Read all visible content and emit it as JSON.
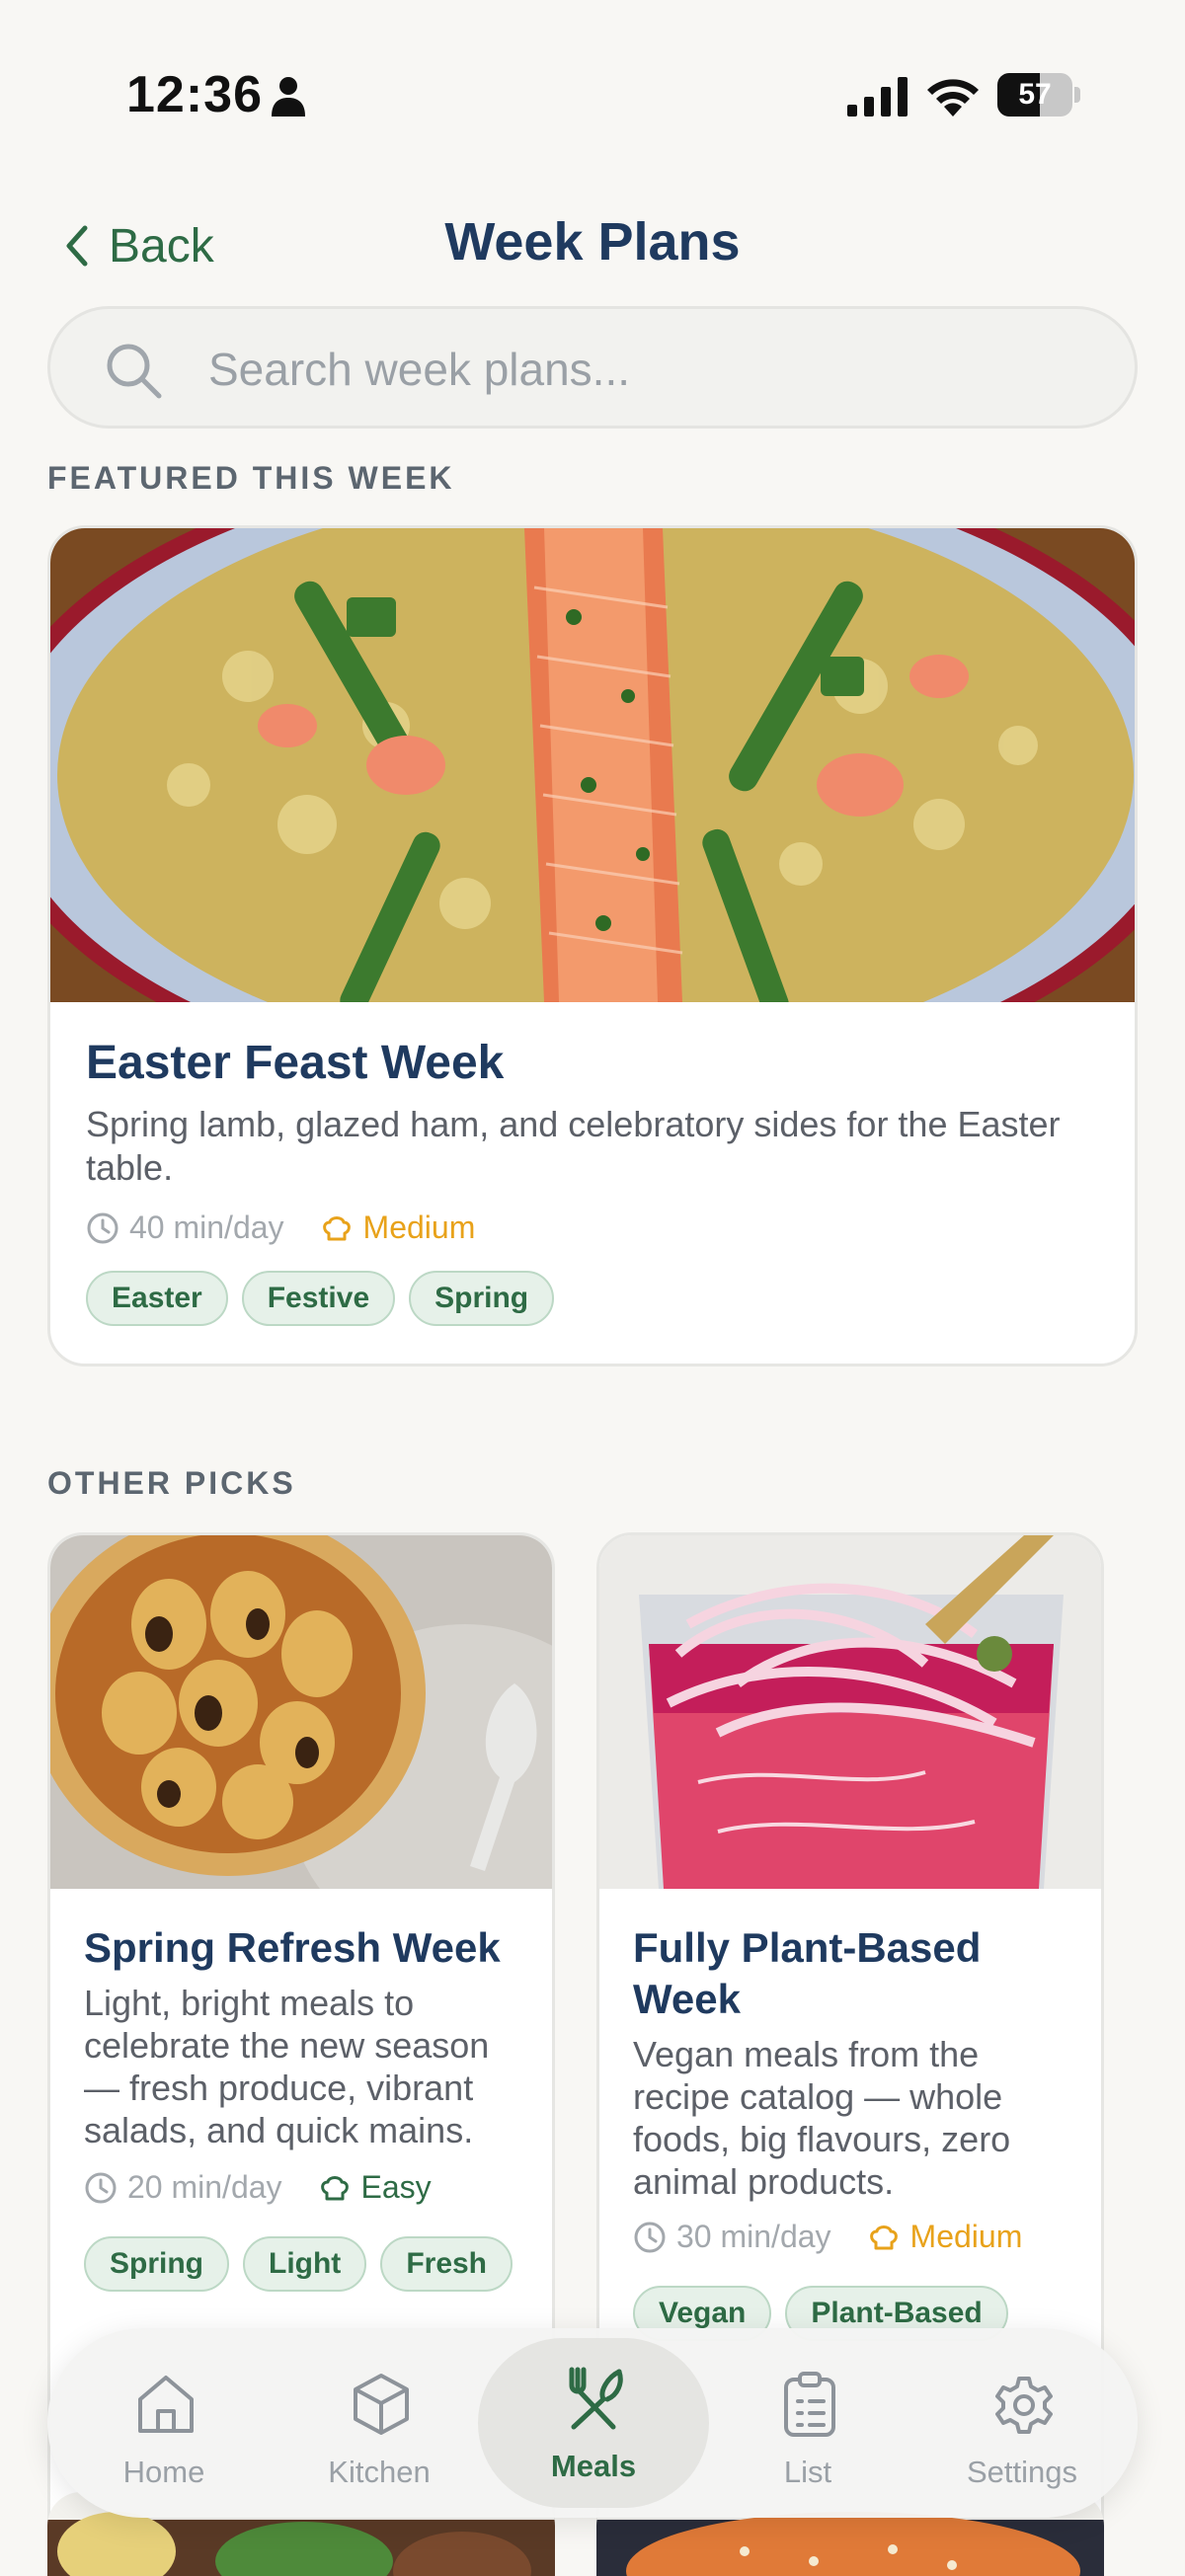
{
  "status_bar": {
    "time": "12:36",
    "battery": "57"
  },
  "header": {
    "back_label": "Back",
    "title": "Week Plans"
  },
  "search": {
    "placeholder": "Search week plans..."
  },
  "featured": {
    "section_label": "FEATURED THIS WEEK",
    "title": "Easter Feast Week",
    "description": "Spring lamb, glazed ham, and celebratory sides for the Easter table.",
    "time": "40 min/day",
    "difficulty": "Medium",
    "tags": [
      "Easter",
      "Festive",
      "Spring"
    ]
  },
  "other_picks": {
    "section_label": "OTHER PICKS",
    "cards": [
      {
        "title": "Spring Refresh Week",
        "description": "Light, bright meals to celebrate the new season — fresh produce, vibrant salads, and quick mains.",
        "time": "20 min/day",
        "difficulty": "Easy",
        "tags": [
          "Spring",
          "Light",
          "Fresh"
        ]
      },
      {
        "title": "Fully Plant-Based Week",
        "description": "Vegan meals from the recipe catalog — whole foods, big flavours, zero animal products.",
        "time": "30 min/day",
        "difficulty": "Medium",
        "tags": [
          "Vegan",
          "Plant-Based"
        ]
      }
    ]
  },
  "tab_bar": {
    "items": [
      {
        "label": "Home",
        "icon": "home-icon"
      },
      {
        "label": "Kitchen",
        "icon": "box-icon"
      },
      {
        "label": "Meals",
        "icon": "fork-knife-icon",
        "active": true
      },
      {
        "label": "List",
        "icon": "clipboard-list-icon"
      },
      {
        "label": "Settings",
        "icon": "gear-icon"
      }
    ]
  },
  "colors": {
    "accent_green": "#2e6b45",
    "title_navy": "#1f3a5f",
    "medium_orange": "#e8a21a",
    "easy_green": "#2e6b45",
    "background": "#f8f7f4"
  }
}
